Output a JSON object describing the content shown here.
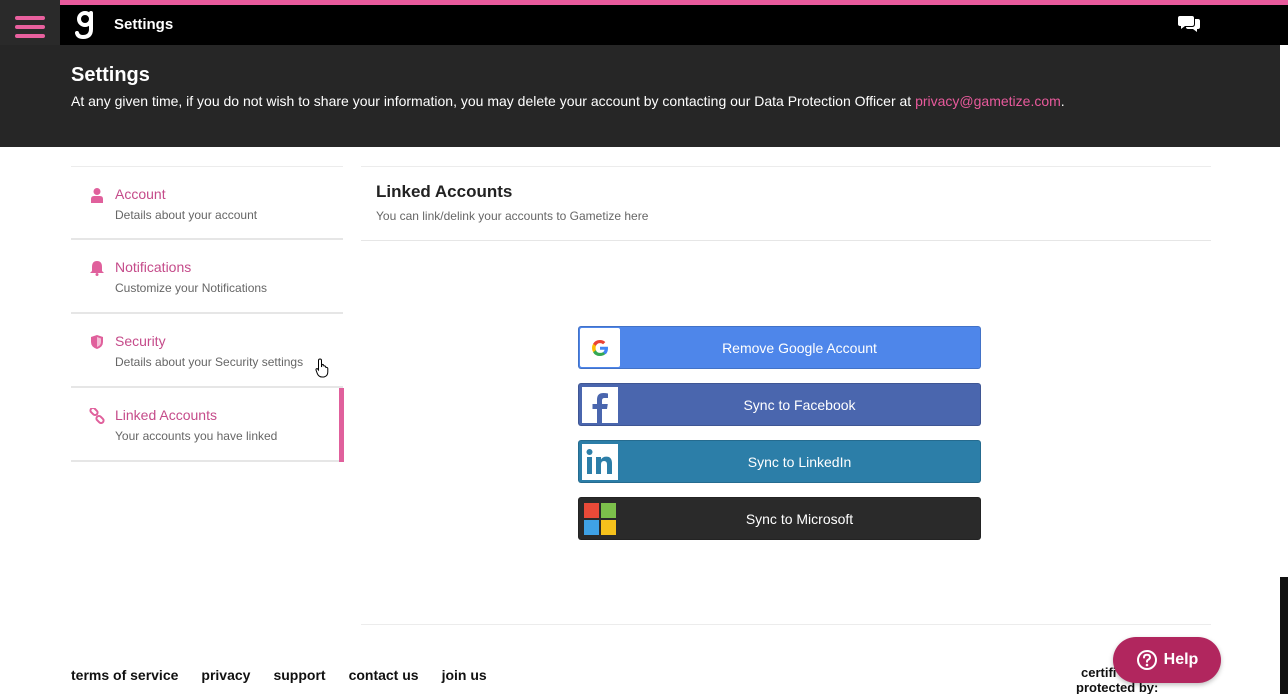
{
  "topbar": {
    "title": "Settings"
  },
  "header": {
    "title": "Settings",
    "text": "At any given time, if you do not wish to share your information, you may delete your account by contacting our Data Protection Officer at ",
    "email": "privacy@gametize.com",
    "suffix": "."
  },
  "sidebar": {
    "items": [
      {
        "label": "Account",
        "desc": "Details about your account",
        "icon": "user-icon"
      },
      {
        "label": "Notifications",
        "desc": "Customize your Notifications",
        "icon": "bell-icon"
      },
      {
        "label": "Security",
        "desc": "Details about your Security settings",
        "icon": "shield-icon"
      },
      {
        "label": "Linked Accounts",
        "desc": "Your accounts you have linked",
        "icon": "link-icon",
        "active": true
      }
    ]
  },
  "main": {
    "title": "Linked Accounts",
    "desc": "You can link/delink your accounts to Gametize here",
    "buttons": {
      "google": "Remove Google Account",
      "facebook": "Sync to Facebook",
      "linkedin": "Sync to LinkedIn",
      "microsoft": "Sync to Microsoft"
    }
  },
  "footer": {
    "links": [
      "terms of service",
      "privacy",
      "support",
      "contact us",
      "join us"
    ],
    "certified_line1": "certifi",
    "certified_line2": "protected by:"
  },
  "help": {
    "label": "Help"
  },
  "colors": {
    "accent": "#e85a9c",
    "help": "#b1265e",
    "google": "#4e86ea",
    "facebook": "#4a66ae",
    "linkedin": "#2c7ea8",
    "microsoft": "#2a2a2a"
  }
}
